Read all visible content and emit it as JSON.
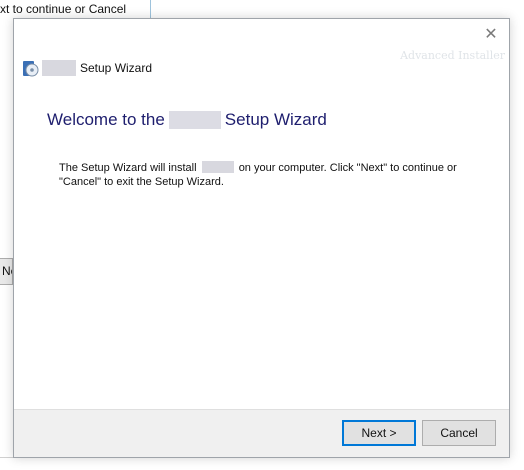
{
  "background_window": {
    "partial_text": "xt to continue or Cancel",
    "partial_button_label": "Ne"
  },
  "dialog": {
    "close_glyph": "✕",
    "branding": "Advanced Installer",
    "header_title": "Setup Wizard",
    "welcome_prefix": "Welcome to the",
    "welcome_suffix": "Setup Wizard",
    "body_part1": "The Setup Wizard will install",
    "body_part2": "on your computer.  Click \"Next\" to continue or \"Cancel\" to exit the Setup Wizard.",
    "buttons": {
      "next": "Next >",
      "cancel": "Cancel"
    }
  },
  "colors": {
    "heading": "#1e1e6e",
    "footer_bg": "#f0f0f0",
    "focus_border": "#0078d7"
  },
  "icons": {
    "app": "installer-disc-icon",
    "close": "close-icon"
  }
}
